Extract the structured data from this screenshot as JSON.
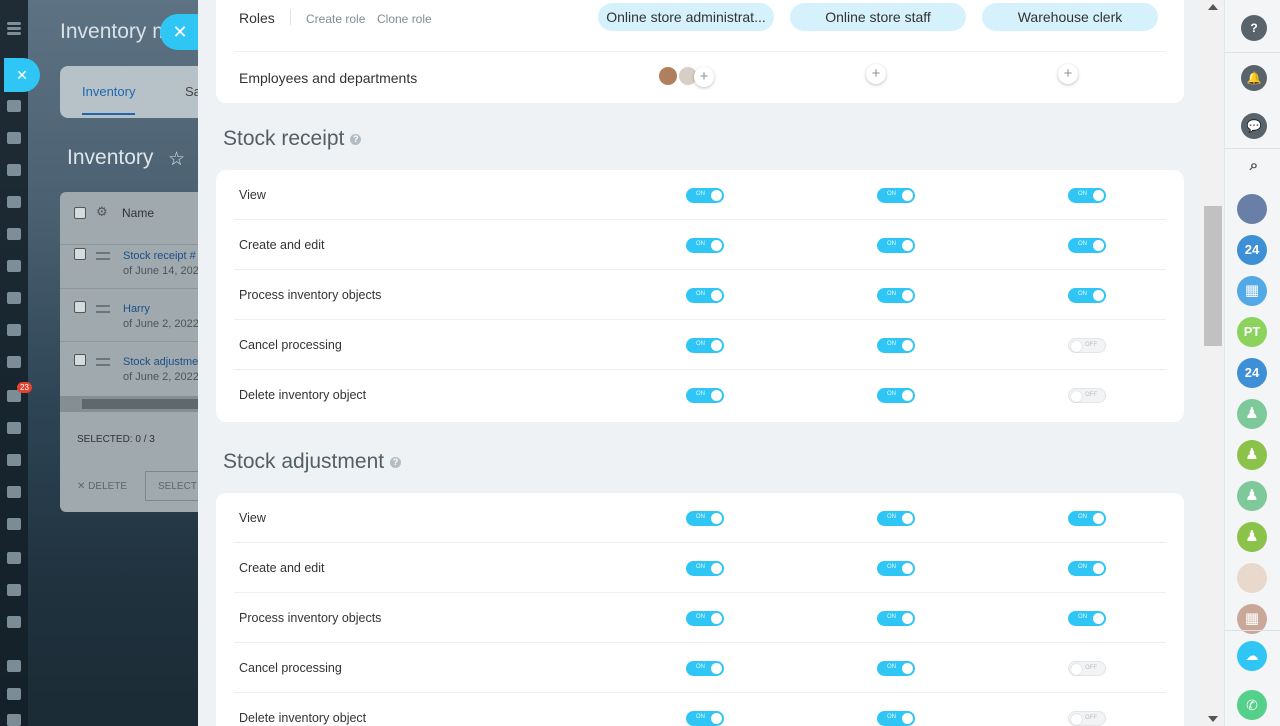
{
  "background": {
    "title": "Inventory m",
    "tabs": [
      {
        "label": "Inventory"
      },
      {
        "label": "Sa"
      }
    ],
    "page_title": "Inventory",
    "grid": {
      "column_name": "Name",
      "rows": [
        {
          "name": "Stock receipt #",
          "date": "of June 14, 202"
        },
        {
          "name": "Harry",
          "date": "of June 2, 2022"
        },
        {
          "name": "Stock adjustme",
          "date": "of June 2, 2022"
        }
      ],
      "selected": "SELECTED: 0 / 3",
      "delete_label": "DELETE",
      "select_label": "SELECT A"
    },
    "sidebar_badge": "23"
  },
  "roles": {
    "label": "Roles",
    "create_role": "Create role",
    "clone_role": "Clone role",
    "columns": [
      {
        "name": "Online store administrat..."
      },
      {
        "name": "Online store staff"
      },
      {
        "name": "Warehouse clerk"
      }
    ],
    "employees_label": "Employees and departments"
  },
  "toggle_text": {
    "on": "ON",
    "off": "OFF"
  },
  "sections": [
    {
      "title": "Stock receipt",
      "permissions": [
        {
          "label": "View",
          "values": [
            true,
            true,
            true
          ]
        },
        {
          "label": "Create and edit",
          "values": [
            true,
            true,
            true
          ]
        },
        {
          "label": "Process inventory objects",
          "values": [
            true,
            true,
            true
          ]
        },
        {
          "label": "Cancel processing",
          "values": [
            true,
            true,
            false
          ]
        },
        {
          "label": "Delete inventory object",
          "values": [
            true,
            true,
            false
          ]
        }
      ]
    },
    {
      "title": "Stock adjustment",
      "permissions": [
        {
          "label": "View",
          "values": [
            true,
            true,
            true
          ]
        },
        {
          "label": "Create and edit",
          "values": [
            true,
            true,
            true
          ]
        },
        {
          "label": "Process inventory objects",
          "values": [
            true,
            true,
            true
          ]
        },
        {
          "label": "Cancel processing",
          "values": [
            true,
            true,
            false
          ]
        },
        {
          "label": "Delete inventory object",
          "values": [
            true,
            true,
            false
          ]
        }
      ]
    }
  ],
  "right_bar": {
    "avatars": [
      {
        "text": "",
        "color": "#6a7fa8"
      },
      {
        "text": "24",
        "color": "#3d8fd6"
      },
      {
        "text": "▦",
        "color": "#53a8e6"
      },
      {
        "text": "PT",
        "color": "#8bd35d"
      },
      {
        "text": "24",
        "color": "#3d8fd6"
      },
      {
        "text": "♟",
        "color": "#7ec99a"
      },
      {
        "text": "♟",
        "color": "#8ac24a"
      },
      {
        "text": "♟",
        "color": "#7ec99a"
      },
      {
        "text": "♟",
        "color": "#8ac24a"
      },
      {
        "text": "",
        "color": "#e9d8cc"
      },
      {
        "text": "▦",
        "color": "#c9a89a"
      }
    ]
  },
  "colors": {
    "accent": "#2fc6f6",
    "pill": "#d5f1fb",
    "call": "#55d08a"
  }
}
